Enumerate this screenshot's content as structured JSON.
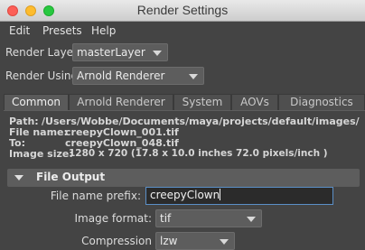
{
  "window": {
    "title": "Render Settings",
    "close_color": "#fc5f57",
    "minimize_color": "#fdbc2e",
    "maximize_color": "#28c840"
  },
  "menubar": {
    "items": [
      "Edit",
      "Presets",
      "Help"
    ]
  },
  "render_layer": {
    "label": "Render Layer",
    "value": "masterLayer"
  },
  "render_using": {
    "label": "Render Using",
    "value": "Arnold Renderer"
  },
  "tabs": [
    {
      "label": "Common",
      "active": true
    },
    {
      "label": "Arnold Renderer",
      "active": false
    },
    {
      "label": "System",
      "active": false
    },
    {
      "label": "AOVs",
      "active": false
    },
    {
      "label": "Diagnostics",
      "active": false
    }
  ],
  "info": {
    "path_label": "Path:",
    "path_value": "/Users/Wobbe/Documents/maya/projects/default/images/",
    "file_name_label": "File name:",
    "file_name_value": "creepyClown_001.tif",
    "to_label": "To:",
    "to_value": "creepyClown_048.tif",
    "image_size_label": "Image size:",
    "image_size_value": "1280 x 720 (17.8 x 10.0 inches 72.0 pixels/inch )"
  },
  "file_output": {
    "section_label": "File Output",
    "prefix_label": "File name prefix:",
    "prefix_value": "creepyClown",
    "format_label": "Image format:",
    "format_value": "tif",
    "compression_label": "Compression",
    "compression_value": "lzw"
  }
}
